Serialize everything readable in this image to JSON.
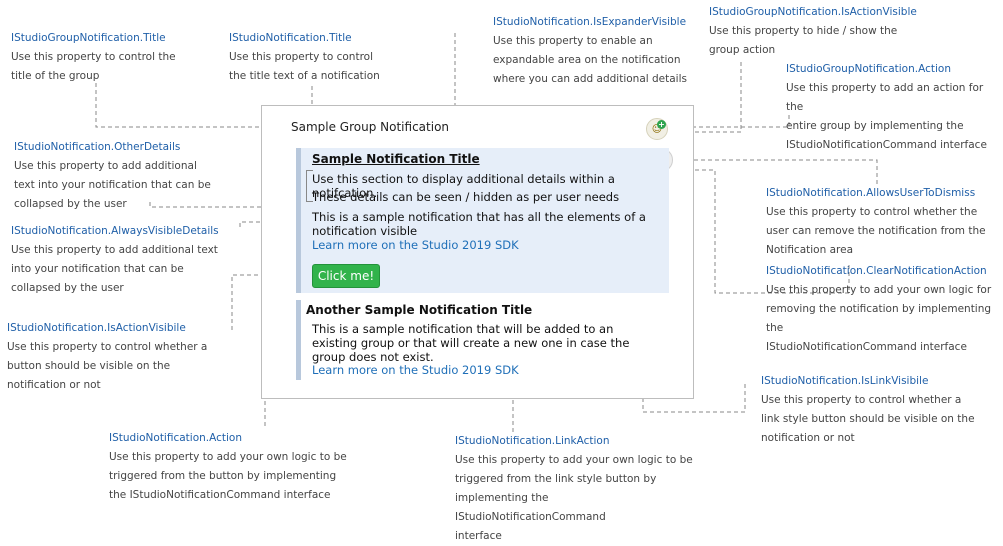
{
  "notification_area": {
    "group_title": "Sample Group Notification",
    "notification1": {
      "title": "Sample Notification Title",
      "other_details_line1": "Use this section to display additional details within a notifcation.",
      "other_details_line2": "These details can be seen / hidden as per user needs",
      "always_visible_details": "This is a sample notification that has all the elements of a notification visible",
      "link_label": "Learn more on the Studio 2019 SDK",
      "button_label": "Click me!"
    },
    "notification2": {
      "title": "Another Sample Notification Title",
      "body": "This is a sample notification that will be added to an existing group or that will create a new one in case the group does not exist.",
      "link_label": "Learn more on the Studio 2019 SDK"
    }
  },
  "annotations": {
    "group_title": {
      "title": "IStudioGroupNotification.Title",
      "desc": "Use this property to control the\ntitle of the group"
    },
    "notif_title": {
      "title": "IStudioNotification.Title",
      "desc": "Use this property to control\nthe title text of a notification"
    },
    "expander": {
      "title": "IStudioNotification.IsExpanderVisible",
      "desc": "Use this property to enable an\nexpandable area on the notification\nwhere you can add additional details"
    },
    "group_action_visible": {
      "title": "IStudioGroupNotification.IsActionVisible",
      "desc": "Use this property to hide / show the\ngroup action"
    },
    "group_action": {
      "title": "IStudioGroupNotification.Action",
      "desc": "Use this property to add an action for the\nentire group by implementing the\nIStudioNotificationCommand interface"
    },
    "other_details": {
      "title": "IStudioNotification.OtherDetails",
      "desc": "Use this property to add additional\ntext into your notification that can be\ncollapsed by the user"
    },
    "always_visible": {
      "title": "IStudioNotification.AlwaysVisibleDetails",
      "desc": "Use this property to add additional text\ninto your notification that can be\ncollapsed by the user"
    },
    "action_visible": {
      "title": "IStudioNotification.IsActionVisibile",
      "desc": "Use this property to control whether a\nbutton should be visible on the\nnotification or not"
    },
    "action": {
      "title": "IStudioNotification.Action",
      "desc": "Use this property to add your own logic to be\ntriggered from the button by implementing\nthe IStudioNotificationCommand interface"
    },
    "link_action": {
      "title": "IStudioNotification.LinkAction",
      "desc": "Use this property to add your own logic to be\ntriggered from the link style button by\nimplementing the IStudioNotificationCommand\ninterface"
    },
    "link_visible": {
      "title": "IStudioNotification.IsLinkVisibile",
      "desc": "Use this property to control whether a\nlink style button should be visible on the\nnotification or not"
    },
    "allows_dismiss": {
      "title": "IStudioNotification.AllowsUserToDismiss",
      "desc": "Use this property to control whether the\nuser can remove the notification from the\nNotification area"
    },
    "clear_action": {
      "title": "IStudioNotification.ClearNotificationAction",
      "desc": "Use this property to add your own logic for\nremoving the notification by implementing the\nIStudioNotificationCommand interface"
    }
  },
  "colors": {
    "annotation_title": "#1f5fa8",
    "card_background": "#e6eef9",
    "button_green": "#31b34b",
    "link_blue": "#1f6fb8",
    "dot_blue": "#4a8fd8"
  },
  "icons": {
    "group_action": "user-add-icon",
    "dismiss": "close-icon"
  }
}
